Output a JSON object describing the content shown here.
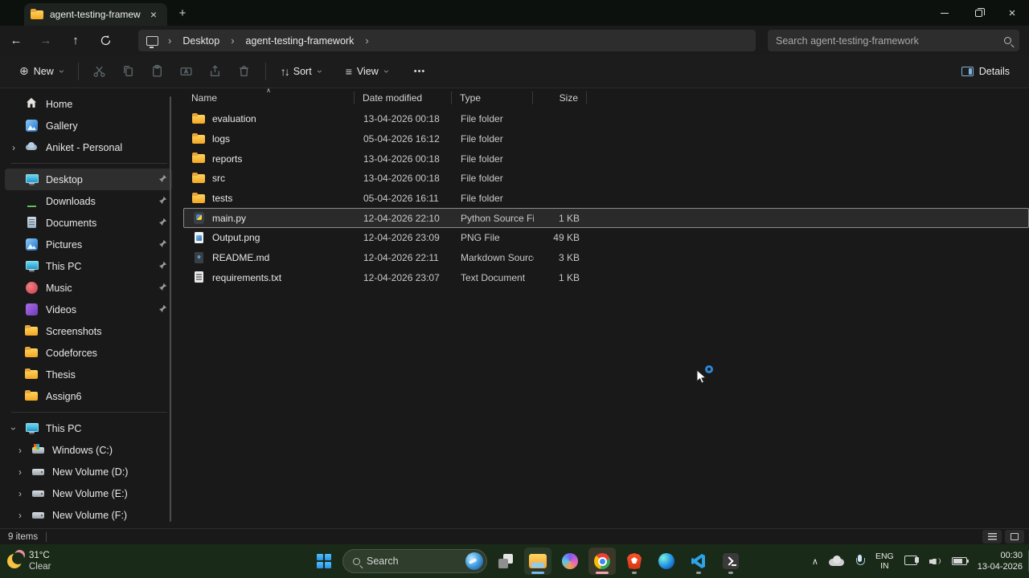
{
  "icons": {
    "back": "←",
    "forward": "→",
    "up": "↑",
    "refresh": "⟳",
    "breadcrumb_sep": "›",
    "chevron": "›",
    "expander_closed": "›",
    "new_glyph": "⊕",
    "sort_glyph": "↑↓",
    "view_glyph": "≡",
    "more_glyph": "•••",
    "close_glyph": "×",
    "plus_glyph": "+",
    "sort_asc": "∧",
    "tray_chevron": "∧",
    "music_note": "♪",
    "play_glyph": "▶",
    "download_arrow": "↓"
  },
  "titlebar": {
    "tab_title": "agent-testing-framework"
  },
  "navbar": {
    "breadcrumb": {
      "root": "Desktop",
      "folder": "agent-testing-framework"
    },
    "search_placeholder": "Search agent-testing-framework"
  },
  "commandbar": {
    "new_label": "New",
    "sort_label": "Sort",
    "view_label": "View",
    "details_label": "Details"
  },
  "columns": {
    "name": "Name",
    "date": "Date modified",
    "type": "Type",
    "size": "Size"
  },
  "files": [
    {
      "name": "evaluation",
      "date": "13-04-2026 00:18",
      "type": "File folder",
      "size": "",
      "row_class": "row",
      "icon_class": "ic ic-folder",
      "icon_name": "folder-icon"
    },
    {
      "name": "logs",
      "date": "05-04-2026 16:12",
      "type": "File folder",
      "size": "",
      "row_class": "row",
      "icon_class": "ic ic-folder",
      "icon_name": "folder-icon"
    },
    {
      "name": "reports",
      "date": "13-04-2026 00:18",
      "type": "File folder",
      "size": "",
      "row_class": "row",
      "icon_class": "ic ic-folder",
      "icon_name": "folder-icon"
    },
    {
      "name": "src",
      "date": "13-04-2026 00:18",
      "type": "File folder",
      "size": "",
      "row_class": "row",
      "icon_class": "ic ic-folder",
      "icon_name": "folder-icon"
    },
    {
      "name": "tests",
      "date": "05-04-2026 16:11",
      "type": "File folder",
      "size": "",
      "row_class": "row",
      "icon_class": "ic ic-folder",
      "icon_name": "folder-icon"
    },
    {
      "name": "main.py",
      "date": "12-04-2026 22:10",
      "type": "Python Source File",
      "size": "1 KB",
      "row_class": "row selected",
      "icon_class": "ic ic-python",
      "icon_name": "python-file-icon"
    },
    {
      "name": "Output.png",
      "date": "12-04-2026 23:09",
      "type": "PNG File",
      "size": "49 KB",
      "row_class": "row",
      "icon_class": "ic ic-image",
      "icon_name": "image-file-icon"
    },
    {
      "name": "README.md",
      "date": "12-04-2026 22:11",
      "type": "Markdown Source ...",
      "size": "3 KB",
      "row_class": "row",
      "icon_class": "ic ic-markdown",
      "icon_name": "markdown-file-icon"
    },
    {
      "name": "requirements.txt",
      "date": "12-04-2026 23:07",
      "type": "Text Document",
      "size": "1 KB",
      "row_class": "row",
      "icon_class": "ic ic-textfile",
      "icon_name": "text-file-icon"
    }
  ],
  "sidebar": {
    "home_label": "Home",
    "gallery_label": "Gallery",
    "onedrive_label": "Aniket - Personal",
    "pinned": [
      {
        "label": "Desktop",
        "item_class": "srow sel",
        "icon_class": "ic ic-desktop",
        "icon_name": "desktop-icon"
      },
      {
        "label": "Downloads",
        "item_class": "srow",
        "icon_class": "ic ic-downloads",
        "icon_name": "downloads-icon"
      },
      {
        "label": "Documents",
        "item_class": "srow",
        "icon_class": "ic ic-documents",
        "icon_name": "documents-icon"
      },
      {
        "label": "Pictures",
        "item_class": "srow",
        "icon_class": "ic ic-pictures",
        "icon_name": "pictures-icon"
      },
      {
        "label": "This PC",
        "item_class": "srow",
        "icon_class": "ic ic-thispc",
        "icon_name": "this-pc-icon"
      },
      {
        "label": "Music",
        "item_class": "srow",
        "icon_class": "ic ic-music",
        "icon_name": "music-icon"
      },
      {
        "label": "Videos",
        "item_class": "srow",
        "icon_class": "ic ic-videos",
        "icon_name": "videos-icon"
      }
    ],
    "folders": [
      {
        "label": "Screenshots"
      },
      {
        "label": "Codeforces"
      },
      {
        "label": "Thesis"
      },
      {
        "label": "Assign6"
      }
    ],
    "thispc_label": "This PC",
    "drives": [
      {
        "label": "Windows (C:)",
        "icon_class": "ic ic-drive-c",
        "icon_name": "windows-drive-icon"
      },
      {
        "label": "New Volume (D:)",
        "icon_class": "ic ic-drive",
        "icon_name": "drive-icon"
      },
      {
        "label": "New Volume (E:)",
        "icon_class": "ic ic-drive",
        "icon_name": "drive-icon"
      },
      {
        "label": "New Volume (F:)",
        "icon_class": "ic ic-drive",
        "icon_name": "drive-icon"
      }
    ]
  },
  "statusbar": {
    "items_count": "9 items"
  },
  "taskbar": {
    "weather": {
      "temp": "31°C",
      "condition": "Clear",
      "badge": "1"
    },
    "search_label": "Search",
    "tray": {
      "lang_line1": "ENG",
      "lang_line2": "IN",
      "time": "00:30",
      "date": "13-04-2026"
    }
  }
}
